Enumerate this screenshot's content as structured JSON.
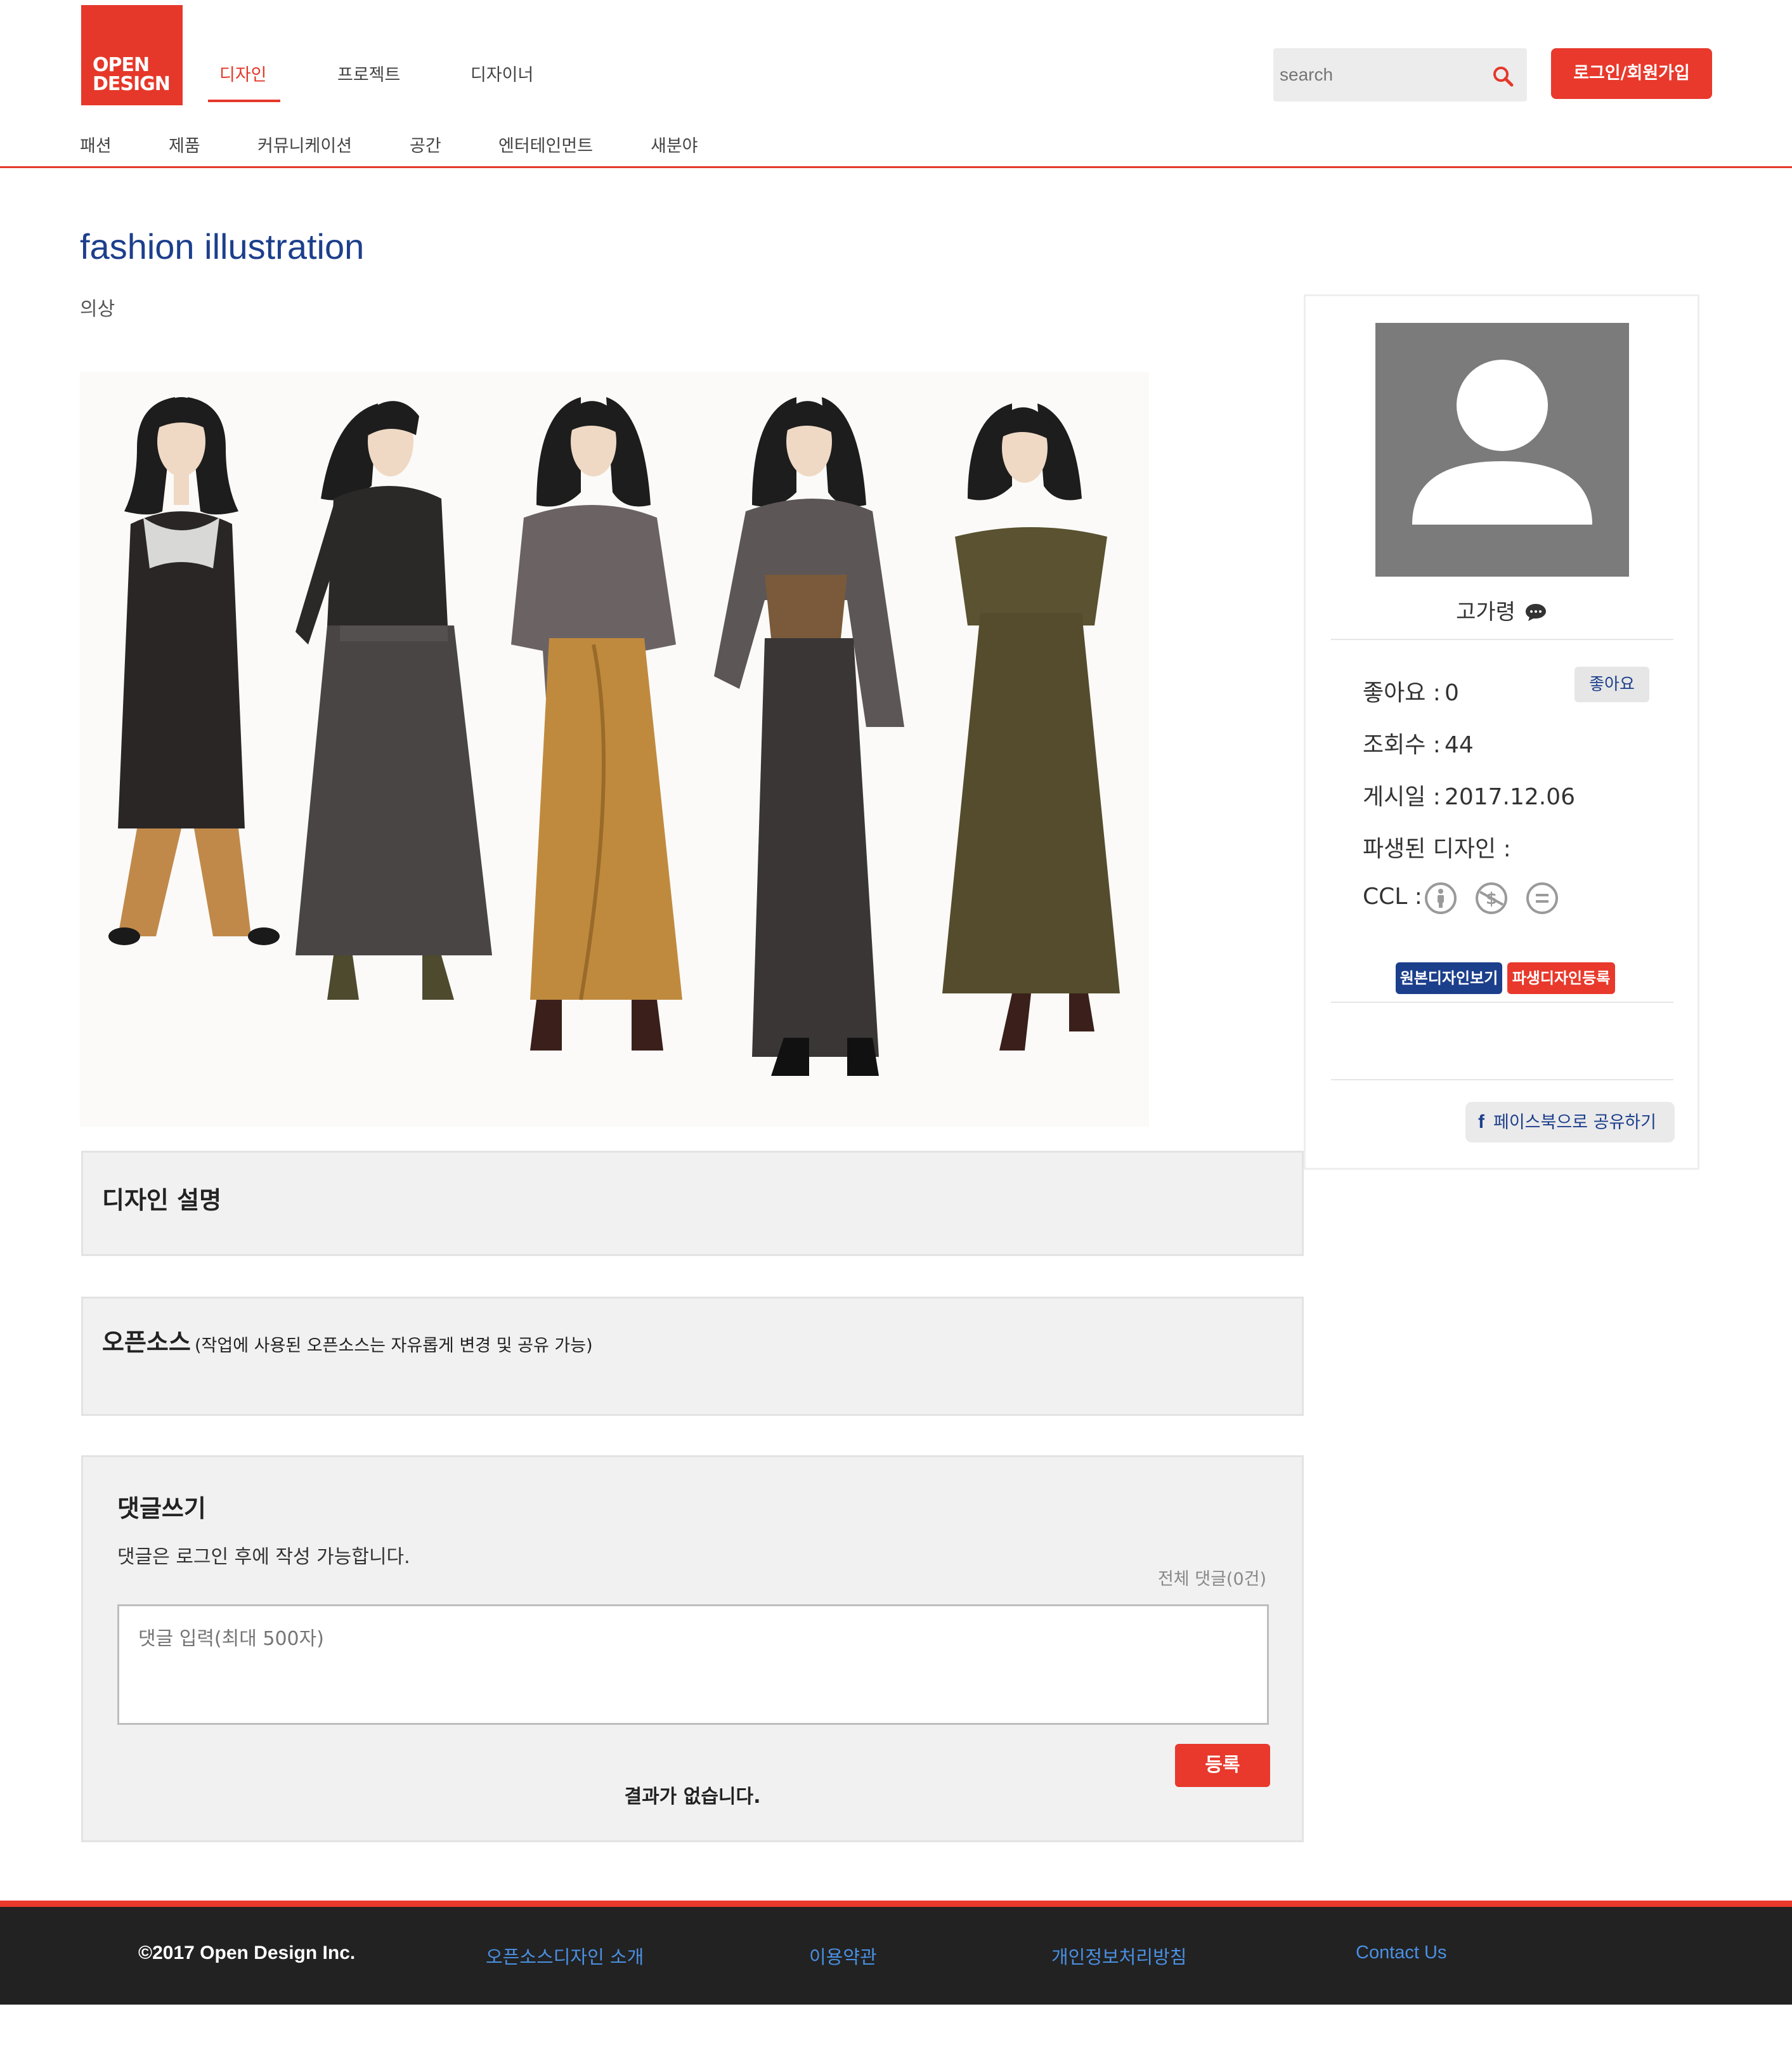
{
  "header": {
    "logo_line1": "OPEN",
    "logo_line2": "DESIGN",
    "main_nav": [
      "디자인",
      "프로젝트",
      "디자이너"
    ],
    "sub_nav": [
      "패션",
      "제품",
      "커뮤니케이션",
      "공간",
      "엔터테인먼트",
      "새분야"
    ],
    "search_placeholder": "search",
    "login_label": "로그인/회원가입",
    "accent_color": "#e5382a"
  },
  "design": {
    "title": "fashion illustration",
    "category": "의상",
    "image_icon": "fashion-illustration-artwork"
  },
  "sections": {
    "description_title": "디자인 설명",
    "opensource_title": "오픈소스",
    "opensource_note": "(작업에 사용된 오픈소스는 자유롭게 변경 및 공유 가능)"
  },
  "comments": {
    "title": "댓글쓰기",
    "login_note": "댓글은 로그인 후에 작성 가능합니다.",
    "total_label": "전체 댓글(0건)",
    "input_placeholder": "댓글 입력(최대 500자)",
    "submit_label": "등록",
    "empty_label": "결과가 없습니다."
  },
  "sidebar": {
    "author": "고가령",
    "likes_label": "좋아요 :",
    "likes_value": "0",
    "like_button": "좋아요",
    "views_label": "조회수 :",
    "views_value": "44",
    "posted_label": "게시일 :",
    "posted_value": "2017.12.06",
    "derived_label": "파생된 디자인 :",
    "ccl_label": "CCL :",
    "ccl_icons": [
      "attribution-icon",
      "noncommercial-icon",
      "no-derivatives-icon"
    ],
    "view_original_button": "원본디자인보기",
    "register_derived_button": "파생디자인등록",
    "facebook_share": "페이스북으로 공유하기",
    "brand_blue": "#1c3f8c"
  },
  "footer": {
    "copyright": "©2017 Open Design Inc.",
    "links": [
      "오픈소스디자인 소개",
      "이용약관",
      "개인정보처리방침",
      "Contact Us"
    ],
    "link_color": "#4a90e2"
  }
}
